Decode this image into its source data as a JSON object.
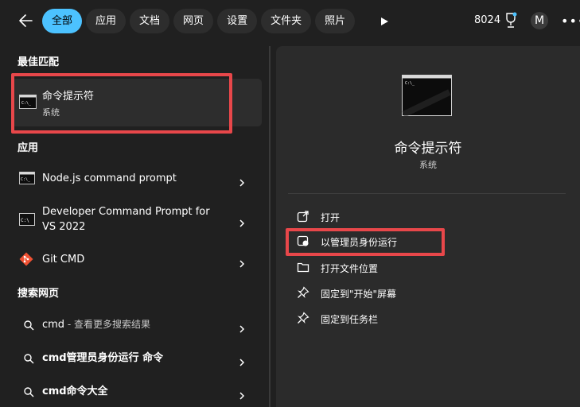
{
  "topbar": {
    "tabs": [
      {
        "label": "全部",
        "active": true
      },
      {
        "label": "应用",
        "active": false
      },
      {
        "label": "文档",
        "active": false
      },
      {
        "label": "网页",
        "active": false
      },
      {
        "label": "设置",
        "active": false
      },
      {
        "label": "文件夹",
        "active": false
      },
      {
        "label": "照片",
        "active": false
      }
    ],
    "points": "8024",
    "avatar_letter": "M",
    "more": "•••"
  },
  "left": {
    "best_match_header": "最佳匹配",
    "best_match": {
      "title": "命令提示符",
      "subtitle": "系统"
    },
    "apps_header": "应用",
    "apps": [
      {
        "label": "Node.js command prompt"
      },
      {
        "label_line1": "Developer Command Prompt for",
        "label_line2": "VS 2022"
      },
      {
        "label": "Git CMD"
      }
    ],
    "web_header": "搜索网页",
    "web": [
      {
        "query": "cmd",
        "suffix": " - 查看更多搜索结果"
      },
      {
        "query": "cmd管理员身份运行 命令"
      },
      {
        "query": "cmd命令大全"
      }
    ]
  },
  "right": {
    "title": "命令提示符",
    "subtitle": "系统",
    "actions": [
      {
        "label": "打开"
      },
      {
        "label": "以管理员身份运行"
      },
      {
        "label": "打开文件位置"
      },
      {
        "label": "固定到\"开始\"屏幕"
      },
      {
        "label": "固定到任务栏"
      }
    ]
  },
  "colors": {
    "accent": "#4cc2ff",
    "highlight": "#e8474a",
    "background": "#202020",
    "panel": "#2b2b2b"
  }
}
